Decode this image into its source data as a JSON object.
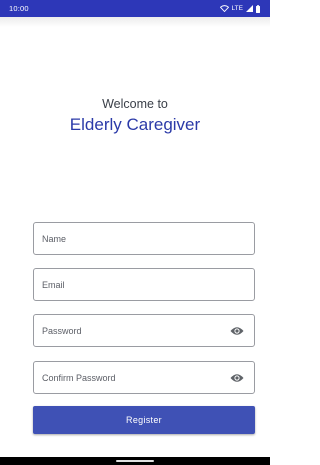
{
  "status_bar": {
    "time": "10:00",
    "network": "LTE",
    "icons": [
      "wifi-icon",
      "cell-signal-icon",
      "battery-icon"
    ],
    "background": "#2d37b8"
  },
  "header": {
    "welcome_text": "Welcome to",
    "app_name": "Elderly Caregiver"
  },
  "form": {
    "name_placeholder": "Name",
    "email_placeholder": "Email",
    "password_placeholder": "Password",
    "confirm_password_placeholder": "Confirm Password",
    "password_toggle_icon": "eye-icon",
    "confirm_toggle_icon": "eye-icon"
  },
  "register_button": {
    "label": "Register",
    "color": "#3f51b5"
  }
}
